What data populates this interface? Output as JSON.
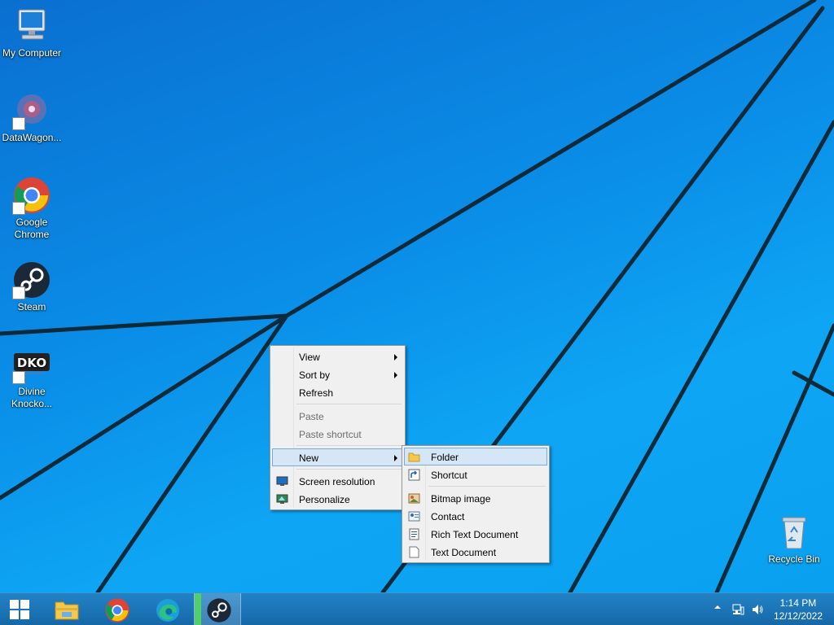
{
  "desktop": {
    "icons": [
      {
        "label": "My Computer"
      },
      {
        "label": "DataWagon..."
      },
      {
        "label": "Google Chrome"
      },
      {
        "label": "Steam"
      },
      {
        "label": "Divine Knocko..."
      },
      {
        "label": "Recycle Bin"
      }
    ],
    "dko_text": "DKO"
  },
  "context_menu": {
    "items": [
      {
        "label": "View",
        "submenu": true
      },
      {
        "label": "Sort by",
        "submenu": true
      },
      {
        "label": "Refresh"
      },
      {
        "label": "Paste",
        "disabled": true
      },
      {
        "label": "Paste shortcut",
        "disabled": true
      },
      {
        "label": "New",
        "submenu": true,
        "highlighted": true
      },
      {
        "label": "Screen resolution",
        "icon": "screen-resolution-icon"
      },
      {
        "label": "Personalize",
        "icon": "personalize-icon"
      }
    ]
  },
  "new_submenu": {
    "items": [
      {
        "label": "Folder",
        "icon": "folder-icon",
        "highlighted": true
      },
      {
        "label": "Shortcut",
        "icon": "shortcut-icon"
      },
      {
        "label": "Bitmap image",
        "icon": "bitmap-icon"
      },
      {
        "label": "Contact",
        "icon": "contact-icon"
      },
      {
        "label": "Rich Text Document",
        "icon": "rich-text-icon"
      },
      {
        "label": "Text Document",
        "icon": "text-document-icon"
      }
    ]
  },
  "taskbar": {
    "pinned": [
      "start-icon",
      "file-explorer-icon",
      "chrome-icon",
      "edge-icon",
      "steam-icon"
    ],
    "clock": {
      "time": "1:14 PM",
      "date": "12/12/2022"
    }
  },
  "colors": {
    "taskbar": "#1a72b4",
    "menu_bg": "#f0f0f0",
    "menu_highlight": "#d5e6f7",
    "active_indicator": "#4fd06b"
  }
}
